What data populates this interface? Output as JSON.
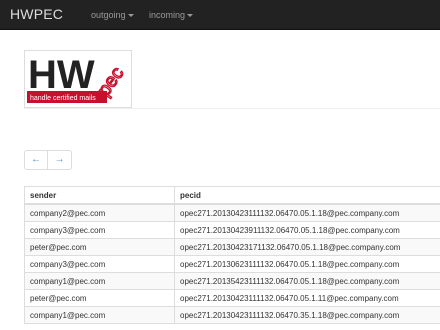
{
  "navbar": {
    "brand": "HWPEC",
    "menus": [
      {
        "label": "outgoing"
      },
      {
        "label": "incoming"
      }
    ]
  },
  "logo": {
    "letters": "HW",
    "sub_letters": "pec",
    "tagline": "handle certified mails",
    "colors": {
      "dark": "#222222",
      "red": "#c8102e"
    }
  },
  "pager": {
    "prev": "←",
    "next": "→"
  },
  "table": {
    "headers": {
      "sender": "sender",
      "pecid": "pecid"
    },
    "rows": [
      {
        "sender": "company2@pec.com",
        "pecid": "opec271.20130423111132.06470.05.1.18@pec.company.com"
      },
      {
        "sender": "company3@pec.com",
        "pecid": "opec271.20130423911132.06470.05.1.18@pec.company.com"
      },
      {
        "sender": "peter@pec.com",
        "pecid": "opec271.20130423171132.06470.05.1.18@pec.company.com"
      },
      {
        "sender": "company3@pec.com",
        "pecid": "opec271.20130623111132.06470.05.1.18@pec.company.com"
      },
      {
        "sender": "company1@pec.com",
        "pecid": "opec271.20135423111132.06470.05.1.18@pec.company.com"
      },
      {
        "sender": "peter@pec.com",
        "pecid": "opec271.20130423111132.06470.05.1.11@pec.company.com"
      },
      {
        "sender": "company1@pec.com",
        "pecid": "opec271.20130423111132.06470.35.1.18@pec.company.com"
      }
    ]
  }
}
